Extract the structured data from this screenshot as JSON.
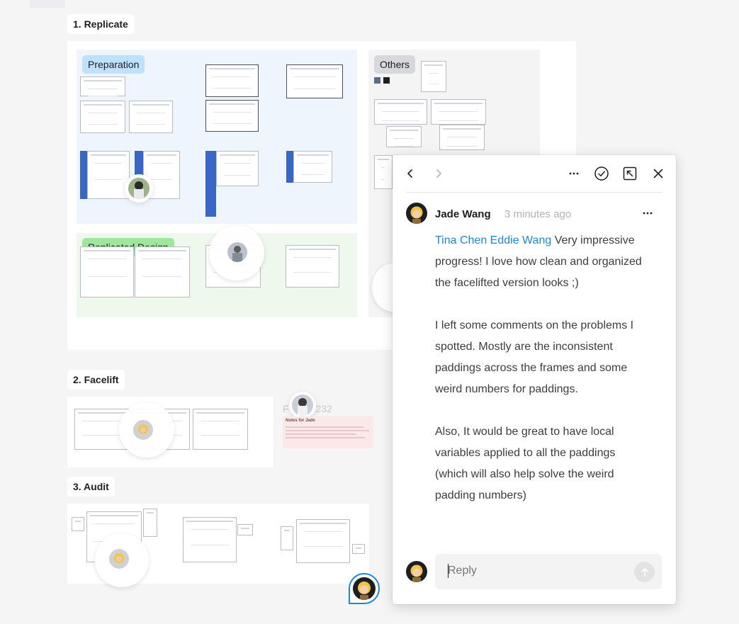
{
  "canvas": {
    "sections": [
      {
        "label": "1. Replicate"
      },
      {
        "label": "2. Facelift"
      },
      {
        "label": "3. Audit"
      }
    ],
    "tags": {
      "preparation": "Preparation",
      "others": "Others",
      "replicated_design": "Replicated Design"
    },
    "frame_label_partial": "F",
    "frame_label_number": "232",
    "note_title": "Notes for Jade"
  },
  "comment": {
    "toolbar": {
      "prev_icon": "chevron-left-icon",
      "next_icon": "chevron-right-icon",
      "more_icon": "more-horizontal-icon",
      "resolve_icon": "check-circle-icon",
      "popout_icon": "arrow-up-left-box-icon",
      "close_icon": "close-icon"
    },
    "author": "Jade Wang",
    "time": "3 minutes ago",
    "mentions": "Tina Chen Eddie Wang",
    "para1_rest": " Very impressive progress! I love how clean and organized the facelifted version looks ;)",
    "para2": "I left some comments on the problems I spotted. Mostly are the inconsistent paddings across the frames and some weird numbers for paddings.",
    "para3": "Also, It would be great to have local variables applied to all the paddings (which will also help solve the weird padding numbers)",
    "reply_placeholder": "Reply"
  },
  "colors": {
    "mention": "#1f86d6",
    "accent": "#1f86d6"
  }
}
